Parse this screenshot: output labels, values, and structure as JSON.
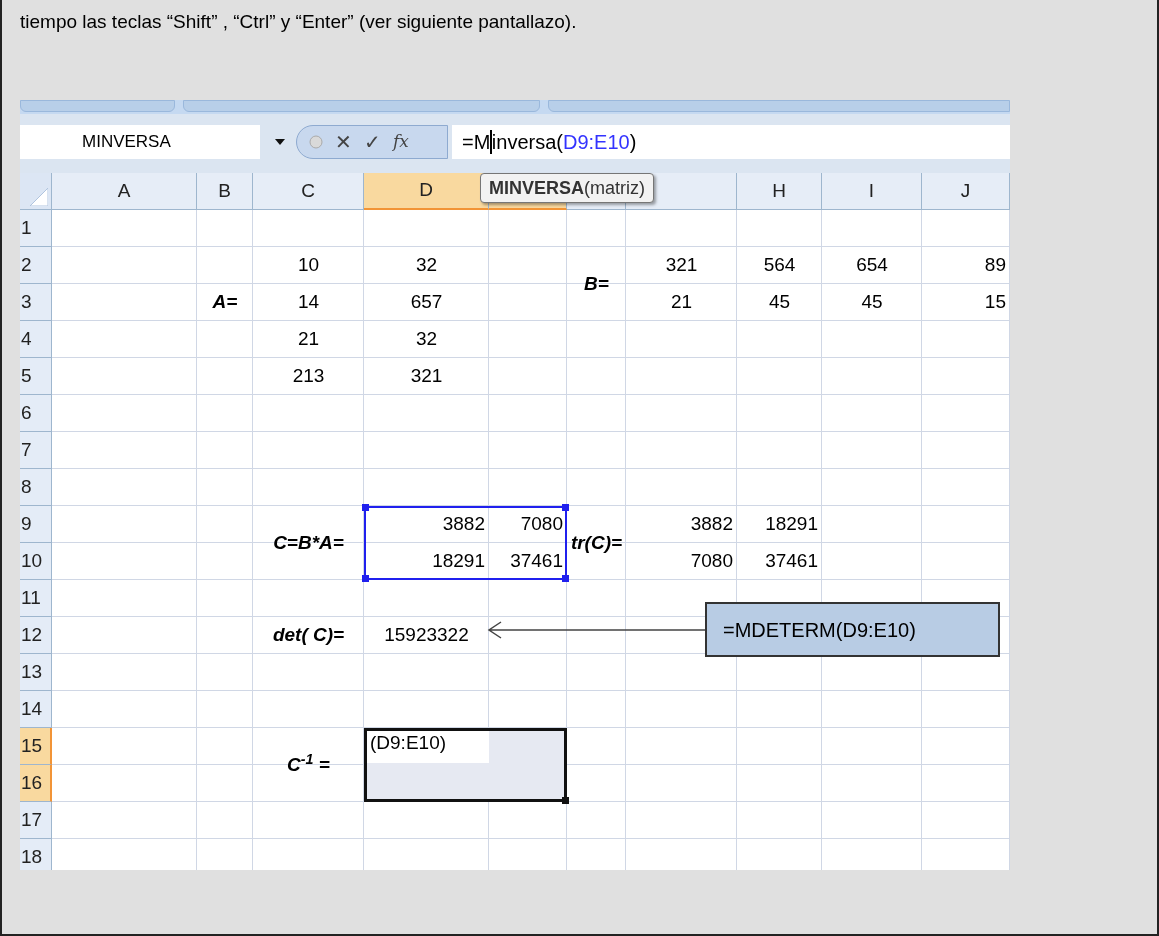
{
  "intro_text": "tiempo las teclas “Shift” , “Ctrl” y “Enter” (ver siguiente pantallazo).",
  "formula_bar": {
    "name_box": "MINVERSA",
    "cancel": "✕",
    "enter": "✓",
    "function": "fx",
    "formula_prefix": "=M",
    "formula_rest": "inversa(",
    "formula_ref": "D9:E10",
    "formula_suffix": ")"
  },
  "tooltip": "**MINVERSA**(matriz)",
  "columns": [
    {
      "label": "A",
      "selected": false
    },
    {
      "label": "B",
      "selected": false
    },
    {
      "label": "C",
      "selected": false
    },
    {
      "label": "D",
      "selected": true
    },
    {
      "selected": true
    },
    {
      "selected": false
    },
    {
      "selected": false
    },
    {
      "label": "H",
      "selected": false
    },
    {
      "label": "I",
      "selected": false
    },
    {
      "label": "J",
      "selected": false
    }
  ],
  "rows": [
    {
      "label": "1",
      "selected": false
    },
    {
      "label": "2",
      "selected": false,
      "cells": [
        null,
        null,
        {
          "text": "10",
          "kind": "center"
        },
        {
          "text": "32",
          "kind": "center"
        },
        null,
        {
          "text": "B=",
          "kind": "label_merged"
        },
        {
          "text": "321",
          "kind": "center"
        },
        {
          "text": "564",
          "kind": "center"
        },
        {
          "text": "654",
          "kind": "center"
        },
        {
          "text": "89",
          "kind": "right"
        }
      ]
    },
    {
      "label": "3",
      "selected": false,
      "cells": [
        null,
        {
          "text": "A=",
          "kind": "label"
        },
        {
          "text": "14",
          "kind": "center"
        },
        {
          "text": "657",
          "kind": "center"
        },
        null,
        null,
        {
          "text": "21",
          "kind": "center"
        },
        {
          "text": "45",
          "kind": "center"
        },
        {
          "text": "45",
          "kind": "center"
        },
        {
          "text": "15",
          "kind": "right"
        }
      ]
    },
    {
      "label": "4",
      "selected": false,
      "cells": [
        null,
        null,
        {
          "text": "21",
          "kind": "center"
        },
        {
          "text": "32",
          "kind": "center"
        }
      ]
    },
    {
      "label": "5",
      "selected": false,
      "cells": [
        null,
        null,
        {
          "text": "213",
          "kind": "center"
        },
        {
          "text": "321",
          "kind": "center"
        }
      ]
    },
    {
      "label": "6",
      "selected": false
    },
    {
      "label": "7",
      "selected": false
    },
    {
      "label": "8",
      "selected": false
    },
    {
      "label": "9",
      "selected": false,
      "cells": [
        null,
        null,
        {
          "text": "C=B*A=",
          "kind": "label_merged"
        },
        {
          "text": "3882",
          "kind": "right"
        },
        {
          "text": "7080",
          "kind": "right"
        },
        {
          "text": "tr(C)=",
          "kind": "label_merged"
        },
        {
          "text": "3882",
          "kind": "right"
        },
        {
          "text": "18291",
          "kind": "right"
        }
      ]
    },
    {
      "label": "10",
      "selected": false,
      "cells": [
        null,
        null,
        null,
        {
          "text": "18291",
          "kind": "right"
        },
        {
          "text": "37461",
          "kind": "right"
        },
        null,
        {
          "text": "7080",
          "kind": "right"
        },
        {
          "text": "37461",
          "kind": "right"
        }
      ]
    },
    {
      "label": "11",
      "selected": false
    },
    {
      "label": "12",
      "selected": false,
      "cells": [
        null,
        null,
        {
          "text": "det( C)=",
          "kind": "label"
        },
        {
          "text": "15923322",
          "kind": "center"
        }
      ]
    },
    {
      "label": "13",
      "selected": false
    },
    {
      "label": "14",
      "selected": false
    },
    {
      "label": "15",
      "selected": true,
      "cells": [
        null,
        null,
        {
          "text": "C$^{-1}$ =",
          "kind": "label_merged"
        },
        {
          "text": "(D9:E10)",
          "kind": "edit"
        }
      ]
    },
    {
      "label": "16",
      "selected": true
    },
    {
      "label": "17",
      "selected": false
    },
    {
      "label": "18",
      "selected": false
    }
  ],
  "callout": "=MDETERM(D9:E10)"
}
